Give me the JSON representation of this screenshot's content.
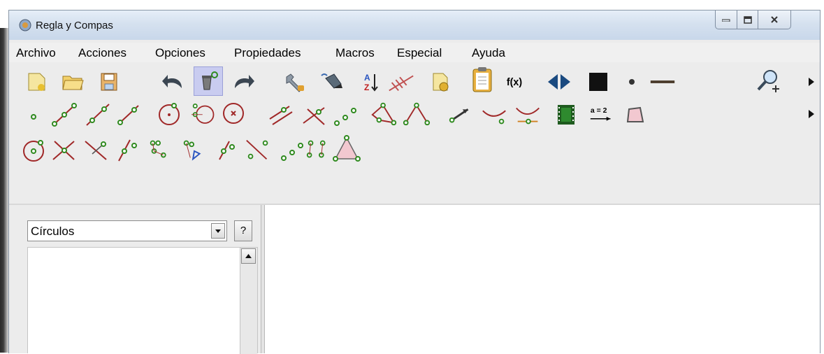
{
  "window": {
    "title": "Regla y Compas"
  },
  "menu": [
    "Archivo",
    "Acciones",
    "Opciones",
    "Propiedades",
    "Macros",
    "Especial",
    "Ayuda"
  ],
  "toolbar": {
    "row1": [
      "new-file",
      "open-file",
      "save-file",
      "undo",
      "delete",
      "redo",
      "edit-object",
      "rename-object",
      "sort-objects",
      "grid",
      "copy-object",
      "clipboard",
      "function",
      "mirror",
      "black-color",
      "point-size",
      "line-thickness",
      "zoom",
      "more"
    ],
    "row1_labels": {
      "sort_top": "A",
      "sort_bottom": "Z",
      "function": "f(x)"
    },
    "row2": [
      "point",
      "segment",
      "line",
      "ray",
      "circle",
      "circle-three-points",
      "fixed-circle",
      "parallel",
      "perpendicular",
      "midpoint",
      "polygon",
      "angle",
      "vector",
      "symmetry",
      "reflection",
      "animation",
      "expression",
      "quadrilateral",
      "more"
    ],
    "row2_labels": {
      "expression": "a = 2"
    },
    "row3": [
      "circle-tangent",
      "intersection",
      "segment-bisector",
      "point-on-line",
      "circle-by-radius",
      "triangle-construct",
      "line-through",
      "distance",
      "points-on-object",
      "locus",
      "triangle"
    ]
  },
  "left_panel": {
    "combo_value": "Círculos",
    "help_label": "?"
  },
  "colors": {
    "accent": "#c9ccf0",
    "point": "#2f8a1f",
    "line": "#a02828",
    "titlebar": "#d5e1ef"
  }
}
